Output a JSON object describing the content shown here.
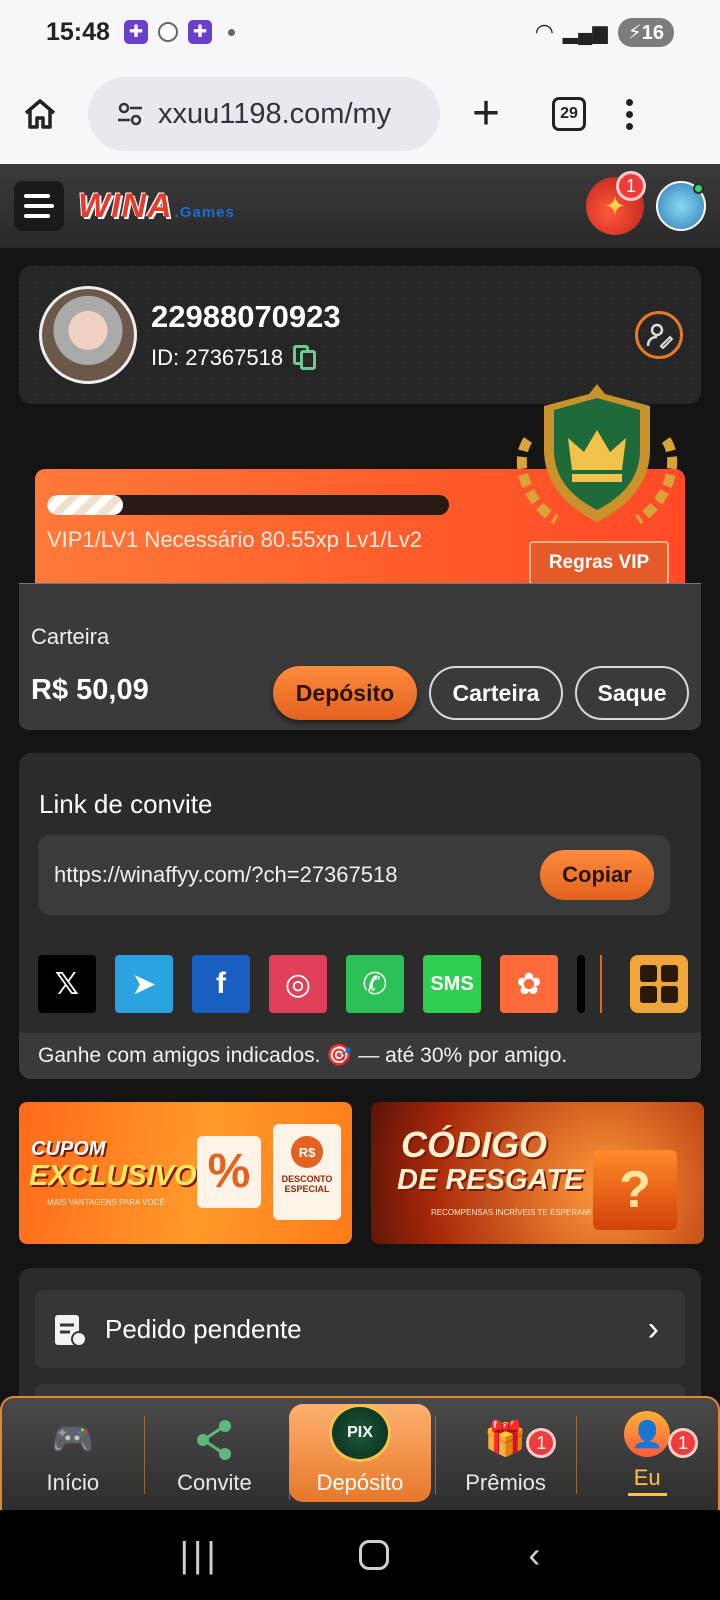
{
  "status_bar": {
    "time": "15:48",
    "battery": "16"
  },
  "browser": {
    "url": "xxuu1198.com/my",
    "tab_count": "29"
  },
  "site": {
    "logo_main": "WINA",
    "logo_sub": ".Games",
    "gift_badge": "1"
  },
  "profile": {
    "username": "22988070923",
    "id_label": "ID: 27367518"
  },
  "vip": {
    "progress_fraction": 0.19,
    "requirement_text": "VIP1/LV1 Necessário 80.55xp Lv1/Lv2",
    "rules_button": "Regras VIP"
  },
  "wallet": {
    "label": "Carteira",
    "balance": "R$ 50,09",
    "deposit_button": "Depósito",
    "wallet_button": "Carteira",
    "withdraw_button": "Saque"
  },
  "invite": {
    "title": "Link de convite",
    "link": "https://winaffyy.com/?ch=27367518",
    "copy_button": "Copiar",
    "share_targets": [
      {
        "name": "x",
        "glyph": "𝕏",
        "color": "#000000"
      },
      {
        "name": "telegram",
        "glyph": "➤",
        "color": "#2aa3e0"
      },
      {
        "name": "facebook",
        "glyph": "f",
        "color": "#1a5fc0"
      },
      {
        "name": "instagram",
        "glyph": "◎",
        "color": "#e0405a"
      },
      {
        "name": "whatsapp",
        "glyph": "✆",
        "color": "#2cc157"
      },
      {
        "name": "sms",
        "glyph": "SMS",
        "color": "#2fcf4f"
      },
      {
        "name": "kwai",
        "glyph": "✿",
        "color": "#ff6a3a"
      }
    ],
    "footer_text": "Ganhe com amigos indicados. 🎯 — até 30% por amigo."
  },
  "banners": {
    "coupon": {
      "line1": "CUPOM",
      "line2": "EXCLUSIVO",
      "tag": "MAIS VANTAGENS PARA VOCÊ",
      "ticket_top": "R$",
      "ticket_bottom": "DESCONTO ESPECIAL",
      "percent": "%"
    },
    "redeem": {
      "line1": "CÓDIGO",
      "line2": "DE RESGATE",
      "tag": "RECOMPENSAS INCRÍVEIS TE ESPERAM!"
    }
  },
  "menu": {
    "pending_orders": "Pedido pendente"
  },
  "bottom_nav": {
    "items": [
      {
        "label": "Início"
      },
      {
        "label": "Convite"
      },
      {
        "label": "Depósito",
        "icon_text": "PIX"
      },
      {
        "label": "Prêmios",
        "badge": "1"
      },
      {
        "label": "Eu",
        "badge": "1"
      }
    ]
  },
  "colors": {
    "accent": "#e2621f",
    "background": "#141414"
  }
}
